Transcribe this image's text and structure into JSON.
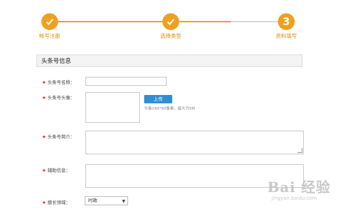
{
  "steps": [
    {
      "label": "帐号注册",
      "state": "done",
      "icon": "check-icon"
    },
    {
      "label": "选择类型",
      "state": "done",
      "icon": "check-icon"
    },
    {
      "label": "资料填写",
      "state": "current",
      "number": "3"
    }
  ],
  "section": {
    "title": "头条号信息"
  },
  "form": {
    "name_label": "头条号名称：",
    "avatar_label": "头条号头像：",
    "upload_label": "上传",
    "avatar_hint": "头像160*90像素，最大为5M",
    "intro_label": "头条号简介：",
    "aux_label": "辅助信息：",
    "field_label": "擅长领域：",
    "field_value": "时政",
    "required_mark": "★"
  },
  "watermark": {
    "logo": "Bai 经验",
    "url": "jingyan.baidu.com"
  },
  "colors": {
    "accent": "#f0a020",
    "button": "#2e8fd6",
    "required": "#e02020"
  }
}
